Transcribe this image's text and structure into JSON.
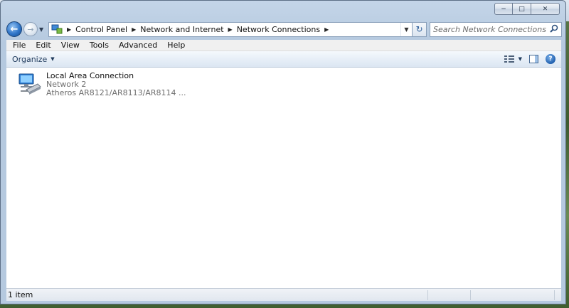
{
  "window": {
    "caption_buttons": {
      "minimize": "−",
      "maximize": "□",
      "close": "✕"
    }
  },
  "navigation": {
    "breadcrumbs": [
      "Control Panel",
      "Network and Internet",
      "Network Connections"
    ],
    "search_placeholder": "Search Network Connections",
    "icons": {
      "back": "back-arrow-icon",
      "forward": "forward-arrow-icon",
      "refresh": "refresh-icon",
      "search": "search-icon"
    }
  },
  "menu": {
    "items": [
      "File",
      "Edit",
      "View",
      "Tools",
      "Advanced",
      "Help"
    ]
  },
  "command_bar": {
    "organize_label": "Organize"
  },
  "content": {
    "connections": [
      {
        "name": "Local Area Connection",
        "network": "Network  2",
        "adapter": "Atheros AR8121/AR8113/AR8114 ..."
      }
    ]
  },
  "status_bar": {
    "item_count": "1 item"
  },
  "colors": {
    "accent": "#2f75c8",
    "command_bar": "#e6eef7",
    "frame": "#b5c9df"
  }
}
